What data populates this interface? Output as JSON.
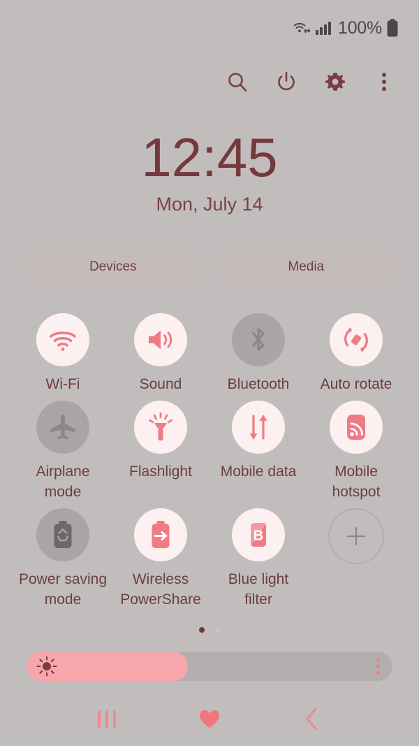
{
  "theme": {
    "background": "#c2bdbd",
    "accent_pink": "#ef7b85",
    "accent_dark": "#75383c",
    "tile_on_bg": "#fdf0f1",
    "tile_off_bg": "#aaa5a5",
    "pill_bg": "#c6bbbb"
  },
  "status_bar": {
    "wifi_icon": "wifi-transfer-icon",
    "signal_icon": "cellular-signal-icon",
    "battery_percent": "100%",
    "battery_icon": "battery-full-icon"
  },
  "toolbar": {
    "buttons": [
      {
        "name": "search-icon",
        "label": "Search"
      },
      {
        "name": "power-icon",
        "label": "Power"
      },
      {
        "name": "gear-icon",
        "label": "Settings"
      },
      {
        "name": "more-options-icon",
        "label": "More options"
      }
    ]
  },
  "clock": {
    "time": "12:45",
    "date": "Mon, July 14"
  },
  "pills": [
    {
      "label": "Devices",
      "name": "devices-button"
    },
    {
      "label": "Media",
      "name": "media-button"
    }
  ],
  "toggles": [
    {
      "label": "Wi-Fi",
      "icon": "wifi-icon",
      "state": "on"
    },
    {
      "label": "Sound",
      "icon": "sound-icon",
      "state": "on"
    },
    {
      "label": "Bluetooth",
      "icon": "bluetooth-icon",
      "state": "off"
    },
    {
      "label": "Auto rotate",
      "icon": "auto-rotate-icon",
      "state": "on"
    },
    {
      "label": "Airplane mode",
      "icon": "airplane-icon",
      "state": "off"
    },
    {
      "label": "Flashlight",
      "icon": "flashlight-icon",
      "state": "on"
    },
    {
      "label": "Mobile data",
      "icon": "mobile-data-icon",
      "state": "on"
    },
    {
      "label": "Mobile hotspot",
      "icon": "mobile-hotspot-icon",
      "state": "on"
    },
    {
      "label": "Power saving mode",
      "icon": "power-saving-icon",
      "state": "off"
    },
    {
      "label": "Wireless PowerShare",
      "icon": "wireless-powershare-icon",
      "state": "on"
    },
    {
      "label": "Blue light filter",
      "icon": "blue-light-filter-icon",
      "state": "on"
    },
    {
      "label": "",
      "icon": "add-tile-icon",
      "state": "add"
    }
  ],
  "page_indicator": {
    "total": 2,
    "active_index": 0
  },
  "brightness": {
    "icon": "brightness-sun-icon",
    "value_percent": 44,
    "menu_icon": "brightness-options-icon"
  },
  "navbar": {
    "buttons": [
      {
        "name": "recents-icon",
        "label": "Recents"
      },
      {
        "name": "home-heart-icon",
        "label": "Home"
      },
      {
        "name": "back-icon",
        "label": "Back"
      }
    ]
  }
}
